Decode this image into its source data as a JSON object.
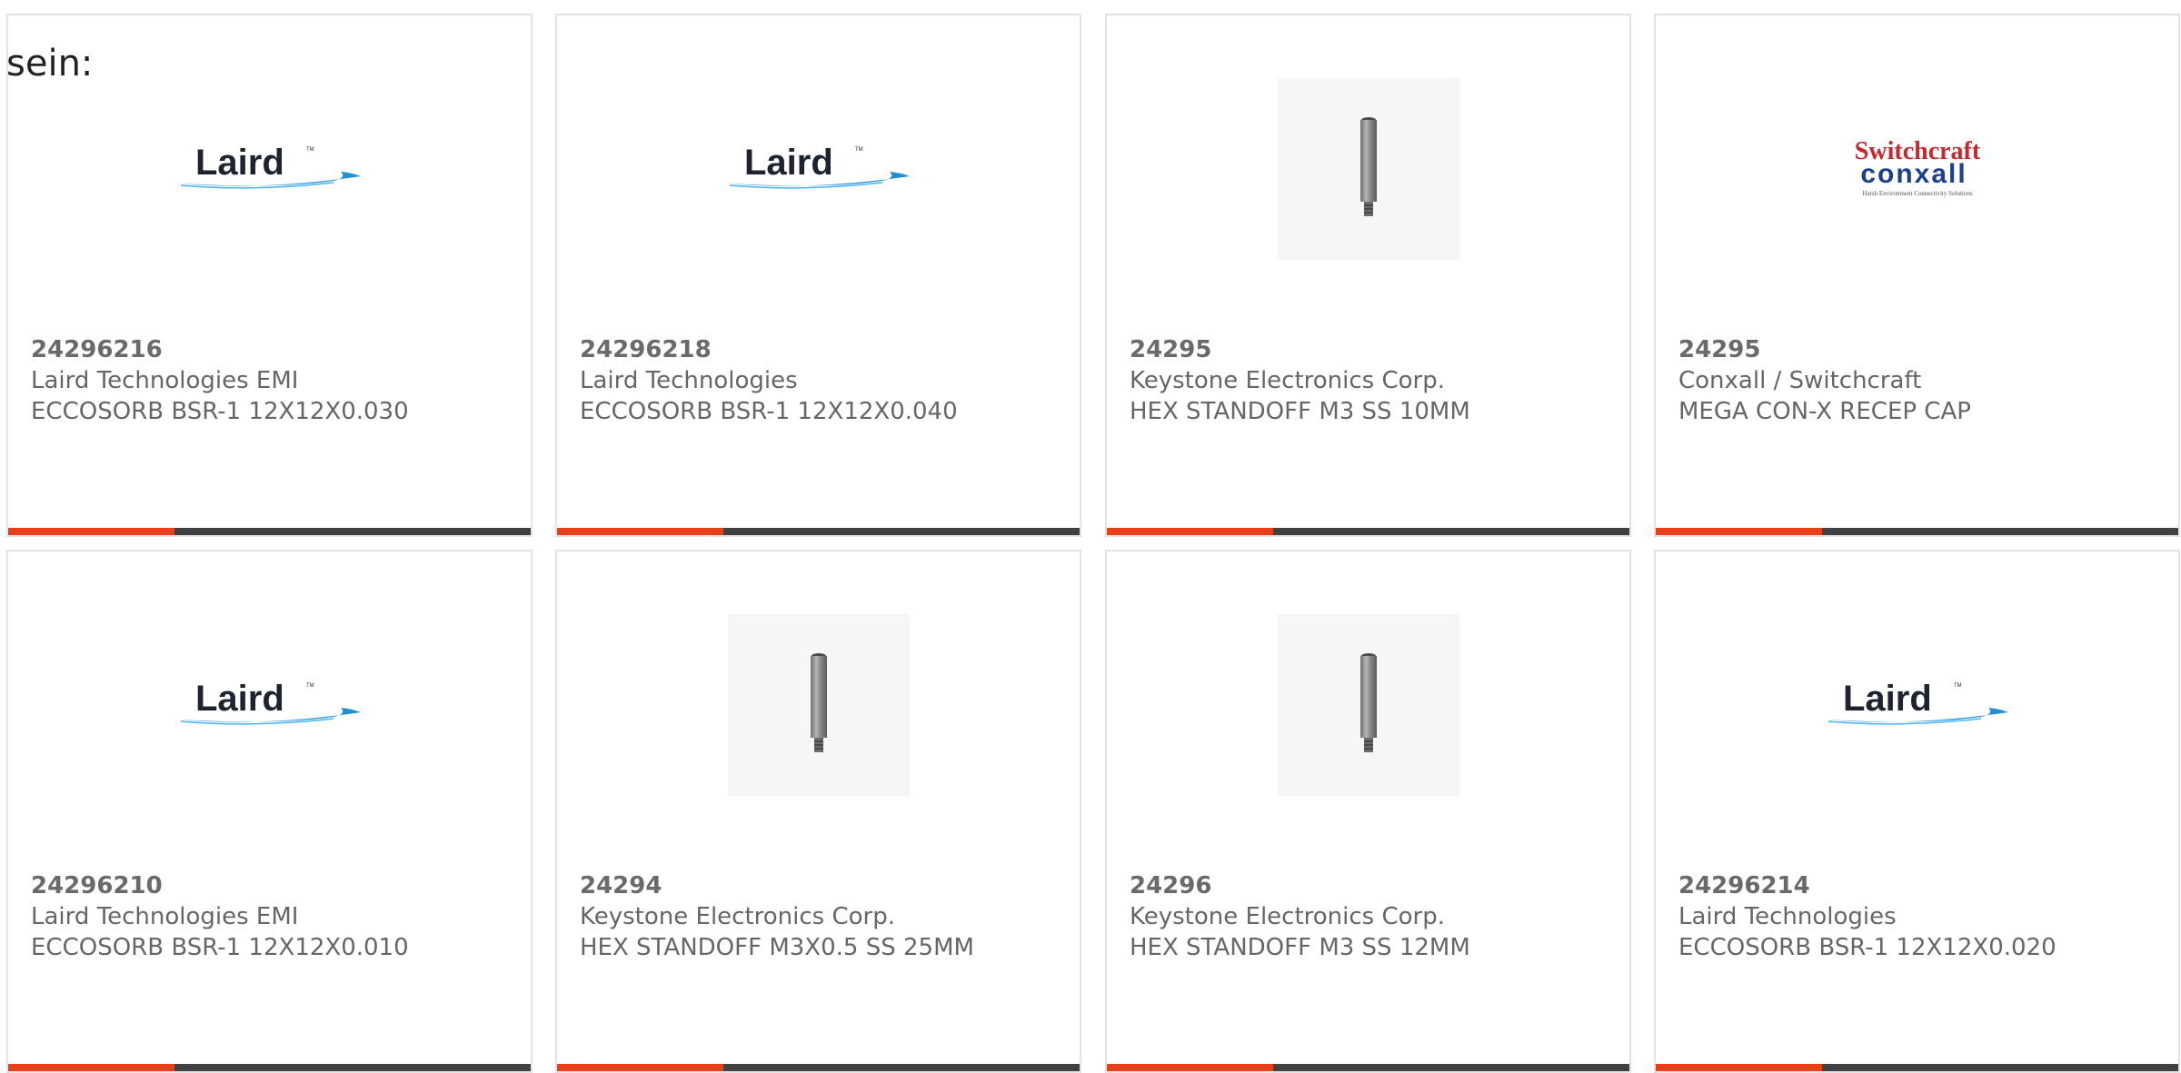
{
  "intro_text": "sein:",
  "accent_color": "#e8411a",
  "bar_color": "#414141",
  "cards": [
    {
      "part_number": "24296216",
      "manufacturer": "Laird Technologies EMI",
      "description": "ECCOSORB BSR-1 12X12X0.030",
      "image": {
        "kind": "laird-logo",
        "logo_text": "Laird"
      }
    },
    {
      "part_number": "24296218",
      "manufacturer": "Laird Technologies",
      "description": "ECCOSORB BSR-1 12X12X0.040",
      "image": {
        "kind": "laird-logo",
        "logo_text": "Laird"
      }
    },
    {
      "part_number": "24295",
      "manufacturer": "Keystone Electronics Corp.",
      "description": "HEX STANDOFF M3 SS 10MM",
      "image": {
        "kind": "standoff-photo"
      }
    },
    {
      "part_number": "24295",
      "manufacturer": "Conxall / Switchcraft",
      "description": "MEGA CON-X RECEP CAP",
      "image": {
        "kind": "switchcraft-logo",
        "logo_line1": "Switchcraft",
        "logo_line2": "conxall",
        "logo_tagline": "Harsh Environment Connectivity Solutions"
      }
    },
    {
      "part_number": "24296210",
      "manufacturer": "Laird Technologies EMI",
      "description": "ECCOSORB BSR-1 12X12X0.010",
      "image": {
        "kind": "laird-logo",
        "logo_text": "Laird"
      }
    },
    {
      "part_number": "24294",
      "manufacturer": "Keystone Electronics Corp.",
      "description": "HEX STANDOFF M3X0.5 SS 25MM",
      "image": {
        "kind": "standoff-photo"
      }
    },
    {
      "part_number": "24296",
      "manufacturer": "Keystone Electronics Corp.",
      "description": "HEX STANDOFF M3 SS 12MM",
      "image": {
        "kind": "standoff-photo"
      }
    },
    {
      "part_number": "24296214",
      "manufacturer": "Laird Technologies",
      "description": "ECCOSORB BSR-1 12X12X0.020",
      "image": {
        "kind": "laird-logo",
        "logo_text": "Laird"
      }
    }
  ]
}
